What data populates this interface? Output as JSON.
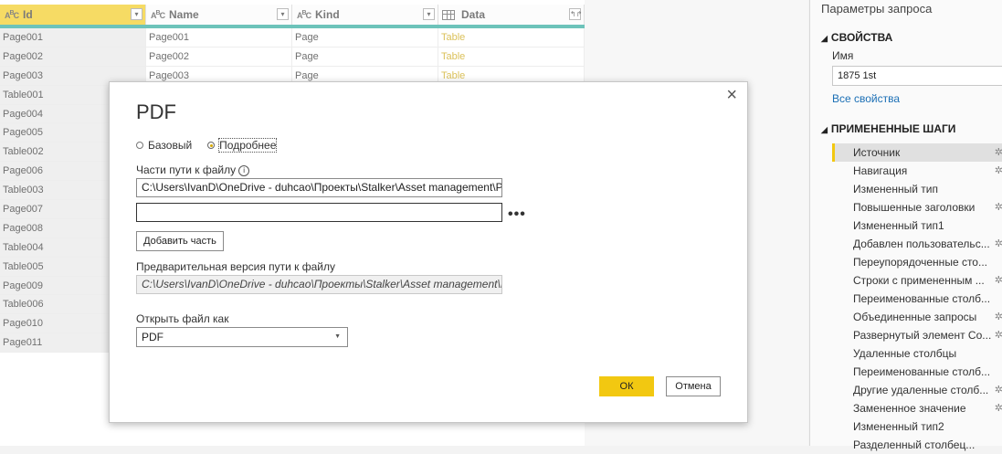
{
  "grid": {
    "columns": [
      {
        "type_icon": "ABC",
        "label": "Id"
      },
      {
        "type_icon": "ABC",
        "label": "Name"
      },
      {
        "type_icon": "ABC",
        "label": "Kind"
      },
      {
        "type_icon": "table",
        "label": "Data"
      }
    ],
    "rows": [
      {
        "id": "Page001",
        "name": "Page001",
        "kind": "Page",
        "data": "Table"
      },
      {
        "id": "Page002",
        "name": "Page002",
        "kind": "Page",
        "data": "Table"
      },
      {
        "id": "Page003",
        "name": "Page003",
        "kind": "Page",
        "data": "Table"
      },
      {
        "id": "Table001"
      },
      {
        "id": "Page004"
      },
      {
        "id": "Page005"
      },
      {
        "id": "Table002"
      },
      {
        "id": "Page006"
      },
      {
        "id": "Table003"
      },
      {
        "id": "Page007"
      },
      {
        "id": "Page008"
      },
      {
        "id": "Table004"
      },
      {
        "id": "Table005"
      },
      {
        "id": "Page009"
      },
      {
        "id": "Table006"
      },
      {
        "id": "Page010"
      },
      {
        "id": "Page011"
      }
    ]
  },
  "pane": {
    "title": "Параметры запроса",
    "properties_header": "СВОЙСТВА",
    "name_label": "Имя",
    "name_value": "1875 1st",
    "all_props_link": "Все свойства",
    "steps_header": "ПРИМЕНЕННЫЕ ШАГИ",
    "steps": [
      {
        "label": "Источник",
        "gear": true
      },
      {
        "label": "Навигация",
        "gear": true
      },
      {
        "label": "Измененный тип",
        "gear": false
      },
      {
        "label": "Повышенные заголовки",
        "gear": true
      },
      {
        "label": "Измененный тип1",
        "gear": false
      },
      {
        "label": "Добавлен пользовательс...",
        "gear": true
      },
      {
        "label": "Переупорядоченные сто...",
        "gear": false
      },
      {
        "label": "Строки с примененным ...",
        "gear": true
      },
      {
        "label": "Переименованные столб...",
        "gear": false
      },
      {
        "label": "Объединенные запросы",
        "gear": true
      },
      {
        "label": "Развернутый элемент Co...",
        "gear": true
      },
      {
        "label": "Удаленные столбцы",
        "gear": false
      },
      {
        "label": "Переименованные столб...",
        "gear": false
      },
      {
        "label": "Другие удаленные столб...",
        "gear": true
      },
      {
        "label": "Замененное значение",
        "gear": true
      },
      {
        "label": "Измененный тип2",
        "gear": false
      },
      {
        "label": "Разделенный столбец...",
        "gear": false
      }
    ]
  },
  "dialog": {
    "title": "PDF",
    "close_icon": "×",
    "radio_basic": "Базовый",
    "radio_advanced": "Подробнее",
    "selected_mode": "advanced",
    "path_parts_label": "Части пути к файлу",
    "path_part_1": "C:\\Users\\IvanD\\OneDrive - duhcao\\Проекты\\Stalker\\Asset management\\P",
    "path_part_2": "",
    "more_icon": "•••",
    "add_part_button": "Добавить часть",
    "preview_label": "Предварительная версия пути к файлу",
    "preview_value": "C:\\Users\\IvanD\\OneDrive - duhcao\\Проекты\\Stalker\\Asset management\\P",
    "open_as_label": "Открыть файл как",
    "open_as_value": "PDF",
    "ok_button": "ОК",
    "cancel_button": "Отмена"
  },
  "colors": {
    "accent": "#f2c811",
    "header_underline": "#1fa495",
    "link": "#1b6fb5",
    "table_value": "#c8a000"
  }
}
